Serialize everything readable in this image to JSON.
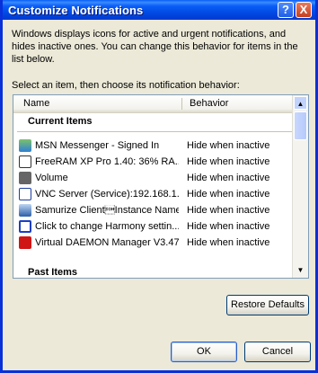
{
  "window": {
    "title": "Customize Notifications",
    "help_glyph": "?",
    "close_glyph": "X"
  },
  "description": "Windows displays icons for active and urgent notifications, and hides inactive ones. You can change this behavior for items in the list below.",
  "select_label": "Select an item, then choose its notification behavior:",
  "list": {
    "columns": {
      "name": "Name",
      "behavior": "Behavior"
    },
    "current_group": "Current Items",
    "past_group": "Past Items",
    "items": [
      {
        "name": "MSN Messenger - Signed In",
        "behavior": "Hide when inactive",
        "icon": "msn-messenger-icon",
        "glyph": ""
      },
      {
        "name": "FreeRAM XP Pro 1.40: 36% RA...",
        "behavior": "Hide when inactive",
        "icon": "freeram-icon",
        "glyph": "93"
      },
      {
        "name": "Volume",
        "behavior": "Hide when inactive",
        "icon": "volume-icon",
        "glyph": ""
      },
      {
        "name": "VNC Server (Service):192.168.1...",
        "behavior": "Hide when inactive",
        "icon": "vnc-icon",
        "glyph": "Vc"
      },
      {
        "name": "Samurize Client\u0001Instance Name:...",
        "behavior": "Hide when inactive",
        "icon": "samurize-icon",
        "glyph": ""
      },
      {
        "name": "Click to change Harmony settin...",
        "behavior": "Hide when inactive",
        "icon": "harmony-icon",
        "glyph": "H"
      },
      {
        "name": "Virtual DAEMON Manager V3.47",
        "behavior": "Hide when inactive",
        "icon": "daemon-icon",
        "glyph": ""
      }
    ]
  },
  "buttons": {
    "restore": "Restore Defaults",
    "ok": "OK",
    "cancel": "Cancel"
  }
}
